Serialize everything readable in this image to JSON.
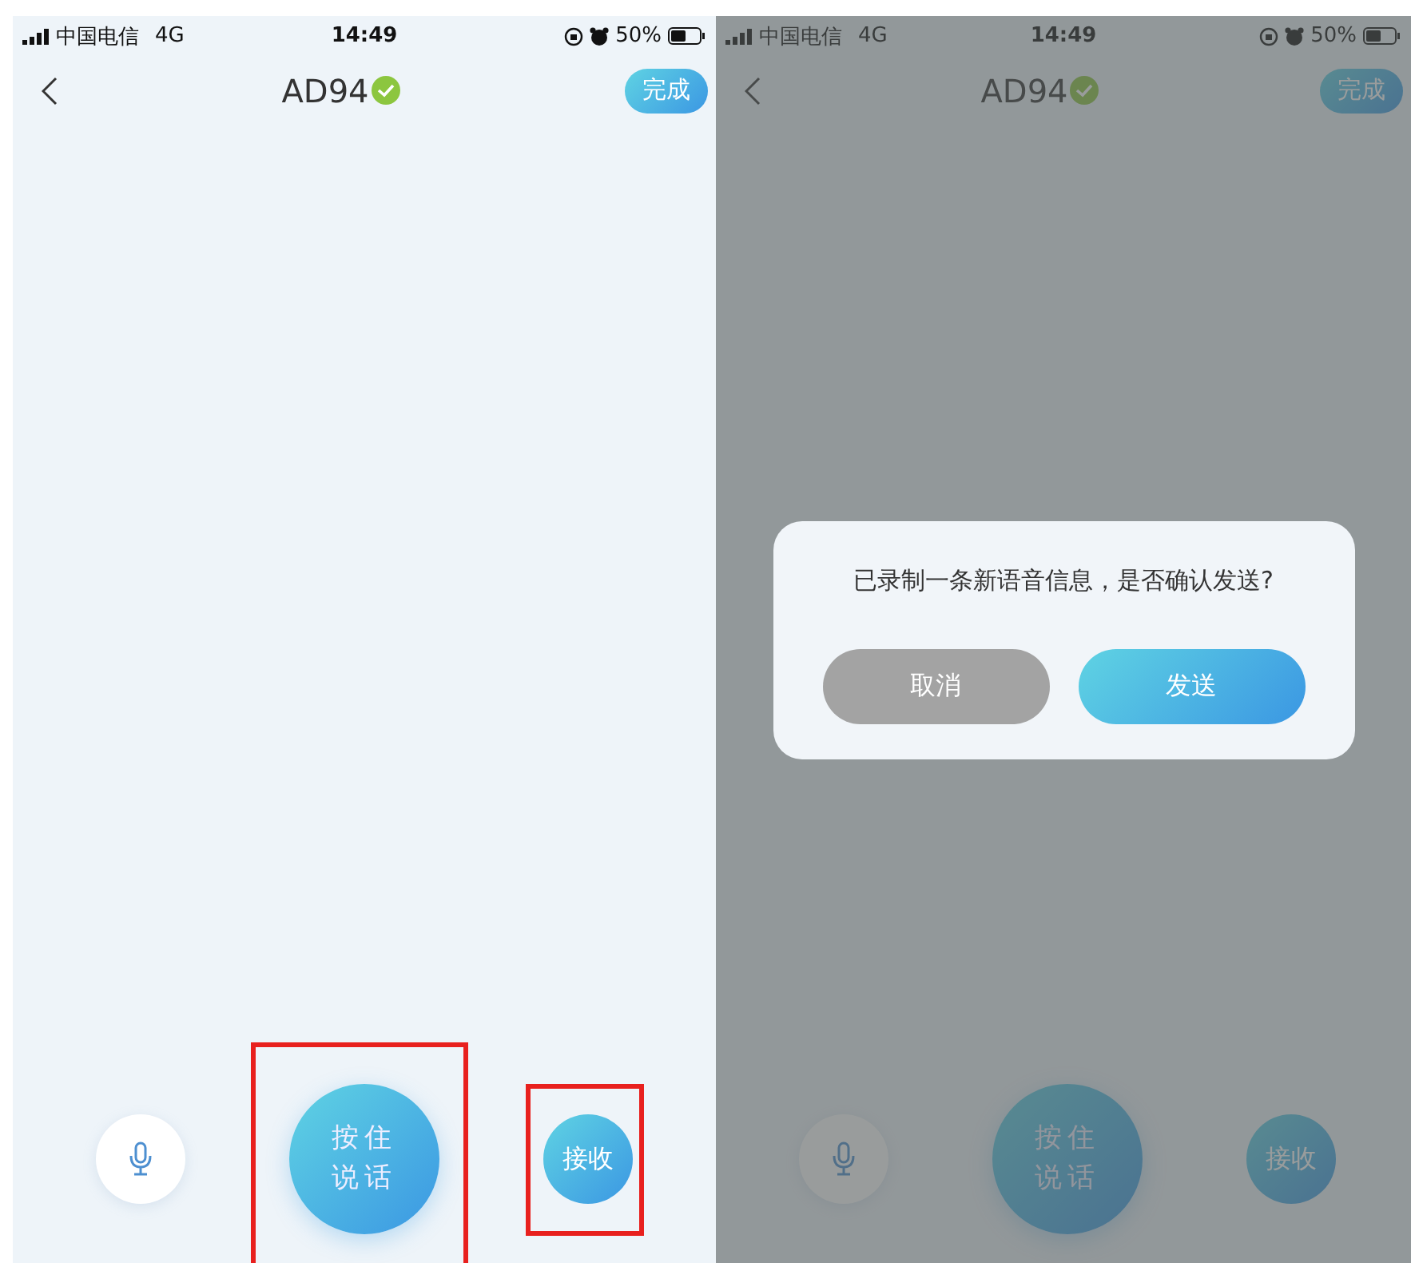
{
  "screens": [
    {
      "status_bar": {
        "carrier": "中国电信",
        "network": "4G",
        "time": "14:49",
        "battery": "50%"
      },
      "nav": {
        "title": "AD94",
        "verified": true,
        "done_button": "完成"
      },
      "controls": [
        {
          "kind": "mic",
          "highlighted": false
        },
        {
          "kind": "talk",
          "label": "按住说话",
          "highlighted": true
        },
        {
          "kind": "receive",
          "label": "接收",
          "highlighted": true
        }
      ]
    },
    {
      "status_bar": {
        "carrier": "中国电信",
        "network": "4G",
        "time": "14:49",
        "battery": "50%"
      },
      "nav": {
        "title": "AD94",
        "verified": true,
        "done_button": "完成"
      },
      "controls": [
        {
          "kind": "mic",
          "highlighted": false
        },
        {
          "kind": "talk",
          "label": "按住说话",
          "highlighted": false
        },
        {
          "kind": "receive",
          "label": "接收",
          "highlighted": false
        }
      ],
      "dialog": {
        "message": "已录制一条新语音信息，是否确认发送?",
        "buttons": [
          {
            "kind": "cancel",
            "label": "取消"
          },
          {
            "kind": "confirm",
            "label": "发送"
          }
        ]
      }
    }
  ]
}
